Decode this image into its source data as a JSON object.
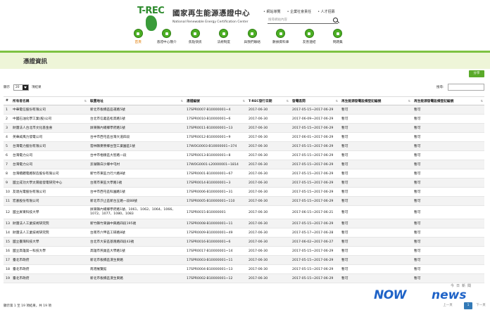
{
  "header": {
    "logo_mark": "T-REC",
    "title": "國家再生能源憑證中心",
    "subtitle": "National Renewable Energy Certification Center",
    "top_links": [
      "網站導覽",
      "企業社會責任",
      "人才招募"
    ],
    "search_placeholder": "搜尋網站內容"
  },
  "nav": [
    {
      "label": "首頁",
      "active": true
    },
    {
      "label": "憑證中心簡介"
    },
    {
      "label": "焦點快訊"
    },
    {
      "label": "法規制度"
    },
    {
      "label": "與我們聯絡"
    },
    {
      "label": "數據資料庫"
    },
    {
      "label": "友善連結"
    },
    {
      "label": "問題集"
    }
  ],
  "page": {
    "title": "憑證資訊",
    "share_label": "分享"
  },
  "controls": {
    "show_prefix": "顯示",
    "page_length": "20",
    "show_suffix": "項結果",
    "filter_label": "搜尋:"
  },
  "table": {
    "columns": [
      "#",
      "所有者名稱",
      "裝置地址",
      "憑證編號",
      "T-REC發行日期",
      "發電區間",
      "再生能源發電設備登記編號",
      "再生能源發電設備登記編號"
    ],
    "rows": [
      [
        "1",
        "中華電信股份有限公司",
        "新北市板橋區區運路5號",
        "17SPR0007-B10000001~4",
        "2017-06-30",
        "2017-05-15~2017-06-29",
        "暫可",
        "暫可"
      ],
      [
        "2",
        "中國石油化學工業(股)公司",
        "台北市信義區松高路1號",
        "17SPR0010-B10000001~6",
        "2017-06-30",
        "2017-06-09~2017-06-29",
        "暫可",
        "暫可"
      ],
      [
        "3",
        "財團法人台北市文化基金會",
        "屏東縣內埔鄉學府路1號",
        "17SPR0011-B10000001~13",
        "2017-06-30",
        "2017-05-15~2017-06-29",
        "暫可",
        "暫可"
      ],
      [
        "4",
        "英華威風力發電公司",
        "台中市西屯區台灣大道四段",
        "17SPR0012-B10000001~9",
        "2017-06-30",
        "2017-06-01~2017-06-29",
        "暫可",
        "暫可"
      ],
      [
        "5",
        "台灣電力股份有限公司",
        "雲林縣麥寮鄉台塑工業園區1號",
        "17WOG0003-B10000001~374",
        "2017-06-30",
        "2017-05-15~2017-06-29",
        "暫可",
        "暫可"
      ],
      [
        "6",
        "台灣電力公司",
        "台中市梧棲區大智路一段",
        "17SPR0013-B10000001~8",
        "2017-06-30",
        "2017-05-15~2017-06-29",
        "暫可",
        "暫可"
      ],
      [
        "7",
        "台灣電力公司",
        "澎湖縣白沙鄉中屯村",
        "17WOG0001-L20000001~1814",
        "2017-06-30",
        "2017-05-15~2017-06-29",
        "暫可",
        "暫可"
      ],
      [
        "8",
        "台灣積體電路製造股份有限公司",
        "新竹市東區力行六路8號",
        "17SPR0001-B10000001~67",
        "2017-06-30",
        "2017-05-15~2017-06-29",
        "暫可",
        "暫可"
      ],
      [
        "9",
        "國立成功大學太陽能發電研究中心",
        "台南市東區大學路1號",
        "17SPR0014-B10000001~3",
        "2017-06-30",
        "2017-05-15~2017-06-29",
        "暫可",
        "暫可"
      ],
      [
        "10",
        "友達光電股份有限公司",
        "台中市西屯區科園路1號",
        "17SPR0006-B10000001~31",
        "2017-06-30",
        "2017-05-15~2017-06-29",
        "暫可",
        "暫可"
      ],
      [
        "11",
        "宏碁股份有限公司",
        "新北市汐止區新台五路一段88號",
        "17SPR0005-B10000001~110",
        "2017-06-30",
        "2017-05-15~2017-06-29",
        "暫可",
        "暫可"
      ],
      [
        "12",
        "國立屏東科技大學",
        "屏東縣內埔鄉學府路1號、1061、1062、1064、1066、1072、1077、1080、1083",
        "17SPR0015-B10000001",
        "2017-06-30",
        "2017-06-15~2017-06-21",
        "暫可",
        "暫可"
      ],
      [
        "13",
        "財團法人工業技術研究院",
        "新竹縣竹東鎮中興路四段195號",
        "17SPR0008-B10000001~11",
        "2017-06-30",
        "2017-05-15~2017-06-29",
        "暫可",
        "暫可"
      ],
      [
        "14",
        "財團法人工業技術研究院",
        "台南市六甲區工研路8號",
        "17SPR0009-B10000001~49",
        "2017-06-30",
        "2017-05-17~2017-06-28",
        "暫可",
        "暫可"
      ],
      [
        "15",
        "國立臺灣科技大學",
        "台北市大安區基隆路四段43號",
        "17SPR0016-B10000001~6",
        "2017-06-30",
        "2017-06-02~2017-06-27",
        "暫可",
        "暫可"
      ],
      [
        "16",
        "國立高雄第一科技大學",
        "高雄市燕巢區大學路1號",
        "17SPR0017-B10000001~14",
        "2017-06-30",
        "2017-05-15~2017-06-29",
        "暫可",
        "暫可"
      ],
      [
        "17",
        "臺北市政府",
        "新北市板橋區漢生東路",
        "17SPR0003-B10000001~11",
        "2017-06-30",
        "2017-05-15~2017-06-29",
        "暫可",
        "暫可"
      ],
      [
        "18",
        "臺北市政府",
        "南港展覽館",
        "17SPR0004-B10000001~13",
        "2017-06-30",
        "2017-05-15~2017-06-29",
        "暫可",
        "暫可"
      ],
      [
        "19",
        "臺北市政府",
        "新北市板橋區漢生東路",
        "17SPR0002-B10000001~12",
        "2017-06-30",
        "2017-05-15~2017-06-29",
        "暫可",
        "暫可"
      ]
    ]
  },
  "footer": {
    "info": "顯示第 1 至 19 項結果，共 19 項",
    "prev": "上一頁",
    "page": "1",
    "next": "下一頁"
  },
  "watermark": {
    "brand_now": "NOW",
    "brand_news": "news",
    "cn": "今日新聞"
  },
  "colors": {
    "brand_green": "#4caf24",
    "band_green": "#7dc242",
    "title_bg": "#eef5d8",
    "pager_blue": "#337ab7"
  }
}
